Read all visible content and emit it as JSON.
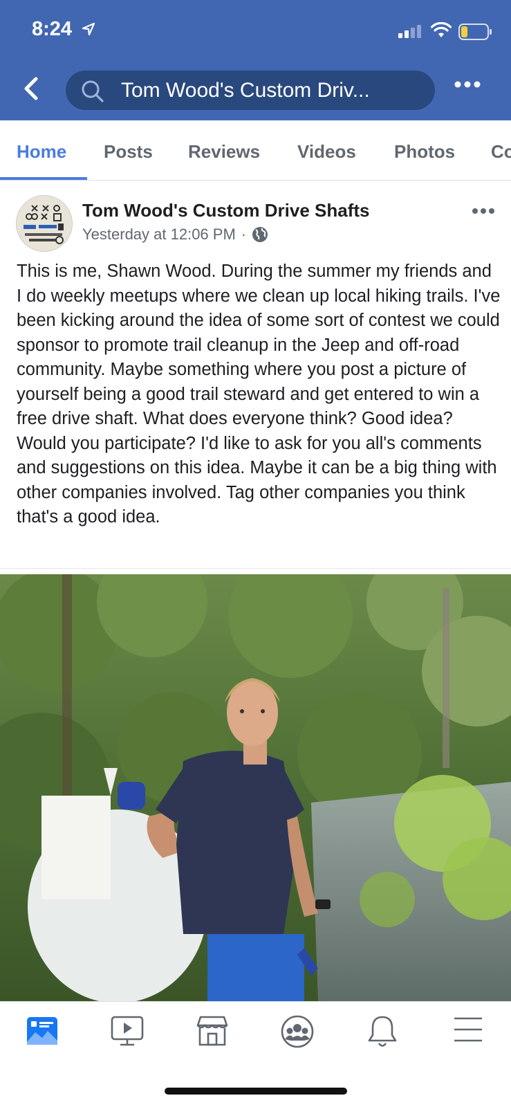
{
  "status_bar": {
    "time": "8:24"
  },
  "header": {
    "search_text": "Tom Wood's Custom Driv..."
  },
  "tabs": [
    {
      "label": "Home",
      "active": true
    },
    {
      "label": "Posts"
    },
    {
      "label": "Reviews"
    },
    {
      "label": "Videos"
    },
    {
      "label": "Photos"
    },
    {
      "label": "Co"
    }
  ],
  "post": {
    "author": "Tom Wood's Custom Drive Shafts",
    "timestamp": "Yesterday at 12:06 PM",
    "separator": "·",
    "privacy_icon": "globe-icon",
    "text": "This is me, Shawn Wood. During the summer my friends and I do weekly meetups where we clean up local hiking trails. I've been kicking around the idea of some sort of contest we could sponsor to promote trail cleanup in the Jeep and off-road community. Maybe something where you post a picture of yourself being a good trail steward and get entered to win a free drive shaft. What does everyone think? Good idea? Would you participate? I'd like to ask for you all's comments and suggestions on this idea. Maybe it can be a big thing with other companies involved. Tag other companies you think that's a good idea."
  },
  "bottom_nav": [
    {
      "icon": "news-feed-icon",
      "active": true
    },
    {
      "icon": "watch-icon"
    },
    {
      "icon": "marketplace-icon"
    },
    {
      "icon": "groups-icon"
    },
    {
      "icon": "notifications-bell-icon"
    },
    {
      "icon": "menu-icon"
    }
  ],
  "colors": {
    "header_bg": "#4267b2",
    "accent": "#4a7cdf",
    "search_bg": "#29487d"
  }
}
